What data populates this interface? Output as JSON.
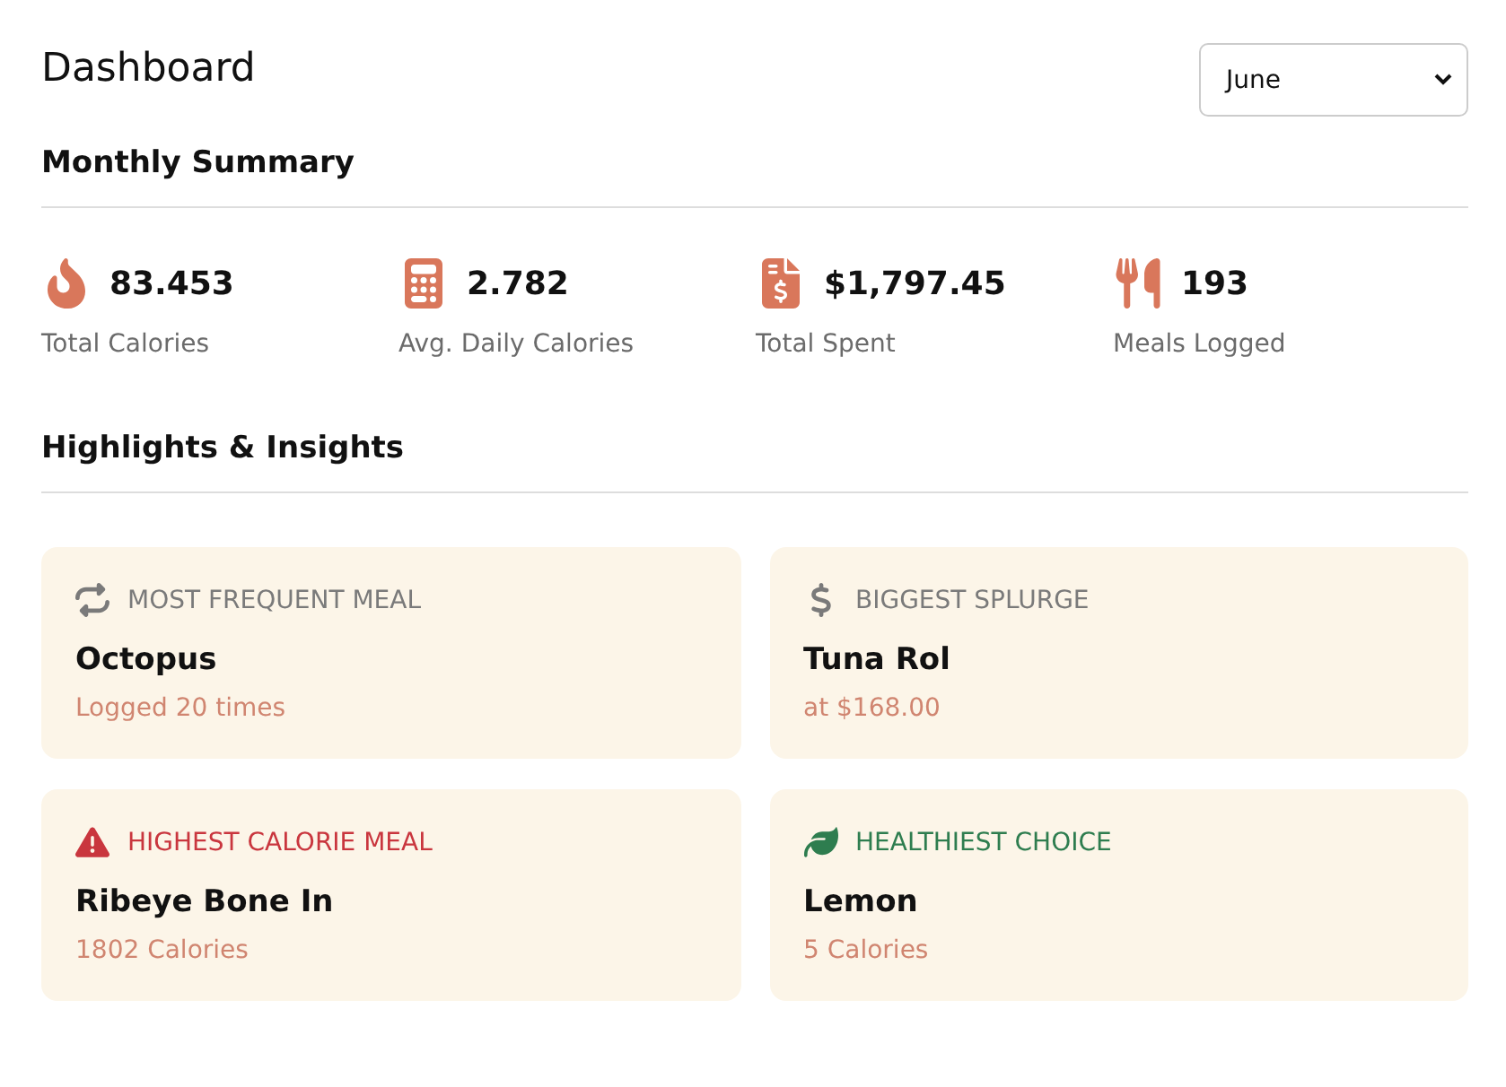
{
  "title": "Dashboard",
  "month_select": {
    "value": "June"
  },
  "summary": {
    "heading": "Monthly Summary",
    "stats": [
      {
        "kind": "calories",
        "value": "83.453",
        "label": "Total Calories"
      },
      {
        "kind": "average",
        "value": "2.782",
        "label": "Avg. Daily Calories"
      },
      {
        "kind": "spent",
        "value": "$1,797.45",
        "label": "Total Spent"
      },
      {
        "kind": "meals",
        "value": "193",
        "label": "Meals Logged"
      }
    ]
  },
  "insights": {
    "heading": "Highlights & Insights",
    "cards": [
      {
        "kind": "frequent",
        "color": "#7a7a7a",
        "label": "MOST FREQUENT MEAL",
        "title": "Octopus",
        "detail": "Logged 20 times"
      },
      {
        "kind": "splurge",
        "color": "#7a7a7a",
        "label": "BIGGEST SPLURGE",
        "title": "Tuna Rol",
        "detail": "at $168.00"
      },
      {
        "kind": "highest",
        "color": "#c9363e",
        "label": "HIGHEST CALORIE MEAL",
        "title": "Ribeye Bone In",
        "detail": "1802 Calories"
      },
      {
        "kind": "healthy",
        "color": "#2e7d4f",
        "label": "HEALTHIEST CHOICE",
        "title": "Lemon",
        "detail": "5 Calories"
      }
    ]
  }
}
